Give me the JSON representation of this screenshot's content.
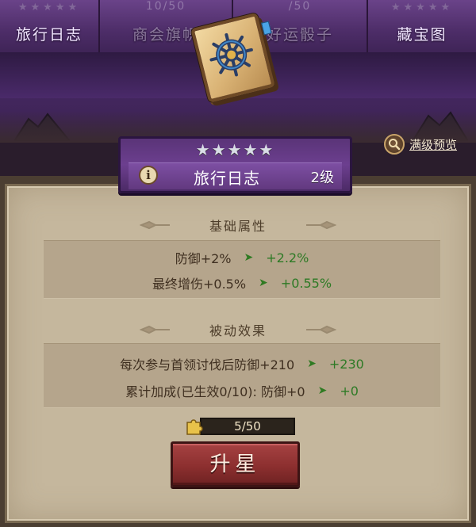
{
  "tabs": [
    {
      "label": "旅行日志",
      "stars": "★★★★★",
      "progress": ""
    },
    {
      "label": "商会旗帜",
      "stars": "",
      "progress": "10/50"
    },
    {
      "label": "好运骰子",
      "stars": "",
      "progress": "/50"
    },
    {
      "label": "藏宝图",
      "stars": "★★★★★",
      "progress": ""
    }
  ],
  "item": {
    "icon": "journal-book-icon",
    "stars": "★★★★★",
    "star_count": 5,
    "name": "旅行日志",
    "level": "2级"
  },
  "max_preview": {
    "label": "满级预览",
    "icon": "magnifier-icon"
  },
  "sections": {
    "base": {
      "title": "基础属性",
      "rows": [
        {
          "current": "防御+2%",
          "next": "+2.2%"
        },
        {
          "current": "最终增伤+0.5%",
          "next": "+0.55%"
        }
      ]
    },
    "passive": {
      "title": "被动效果",
      "rows": [
        {
          "current": "每次参与首领讨伐后防御+210",
          "next": "+230"
        },
        {
          "current": "累计加成(已生效0/10): 防御+0",
          "next": "+0"
        }
      ]
    }
  },
  "upgrade": {
    "cost_icon": "puzzle-piece-icon",
    "cost": "5/50",
    "button_label": "升星"
  },
  "colors": {
    "tab_purple": "#6a4389",
    "badge_purple": "#6c3f8f",
    "parchment": "#c5b79d",
    "green_value": "#2d7a25",
    "button_red": "#8c2f2f"
  }
}
